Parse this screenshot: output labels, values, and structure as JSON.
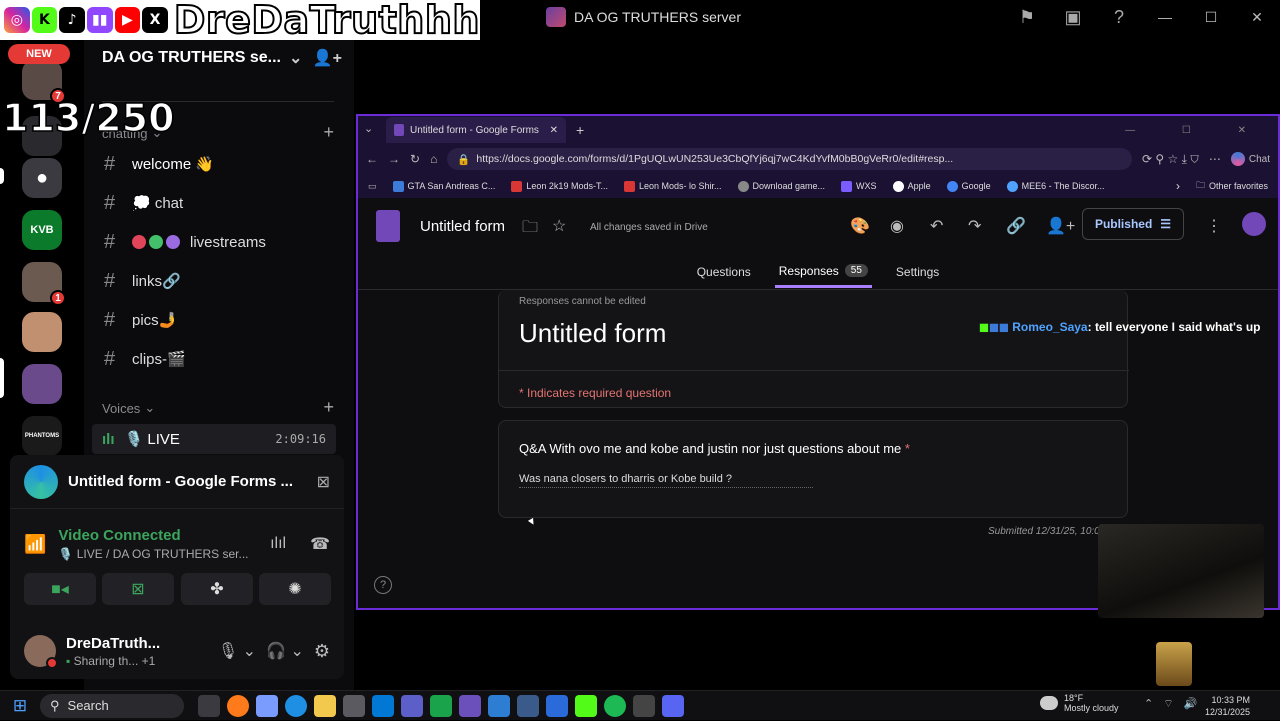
{
  "overlay": {
    "streamer_name": "DreDaTruthhh",
    "counter": "113/250",
    "social_icons": [
      "instagram-icon",
      "kick-icon",
      "tiktok-icon",
      "twitch-icon",
      "youtube-icon",
      "x-icon"
    ]
  },
  "window": {
    "title": "DA OG TRUTHERS server"
  },
  "rail": {
    "new_badge": "NEW",
    "servers": [
      {
        "label": "",
        "badge": "7"
      },
      {
        "label": "",
        "badge": ""
      },
      {
        "label": "",
        "badge": ""
      },
      {
        "label": "KVB",
        "badge": ""
      },
      {
        "label": "",
        "badge": "1"
      },
      {
        "label": "",
        "badge": ""
      },
      {
        "label": "",
        "badge": ""
      },
      {
        "label": "PHANTOMS",
        "badge": ""
      }
    ]
  },
  "sidebar": {
    "server_name": "DA OG TRUTHERS se...",
    "categories": {
      "chatting": "chatting",
      "voices": "Voices"
    },
    "channels": [
      {
        "name": "welcome 👋"
      },
      {
        "name": "💭 chat"
      },
      {
        "name": "livestreams"
      },
      {
        "name": "links🔗"
      },
      {
        "name": "pics🤳"
      },
      {
        "name": "clips-🎬"
      }
    ],
    "live_channel": {
      "name": "🎙️ LIVE",
      "time": "2:09:16"
    }
  },
  "voice_panel": {
    "stream_title": "Untitled form - Google Forms ...",
    "status": "Video Connected",
    "sub": "🎙️ LIVE / DA OG TRUTHERS ser...",
    "user_name": "DreDaTruth...",
    "user_status": "Sharing th...",
    "user_status_extra": "+1"
  },
  "browser": {
    "tab_title": "Untitled form - Google Forms",
    "url": "https://docs.google.com/forms/d/1PgUQLwUN253Ue3CbQfYj6qj7wC4KdYvfM0bB0gVeRr0/edit#resp...",
    "chat_button": "Chat",
    "favorites": [
      "GTA San Andreas C...",
      "Leon 2k19 Mods-T...",
      "Leon Mods- lo Shir...",
      "Download game...",
      "WXS",
      "Apple",
      "Google",
      "MEE6 - The Discor..."
    ],
    "favorites_colors": [
      "#3d7bd9",
      "#d93636",
      "#d93636",
      "#888888",
      "#7a5cff",
      "#ffffff",
      "#4285f4",
      "#4fa3ff"
    ],
    "other_favorites": "Other favorites"
  },
  "form": {
    "title": "Untitled form",
    "saved_status": "All changes saved in Drive",
    "publish_label": "Published",
    "tabs": {
      "questions": "Questions",
      "responses": "Responses",
      "responses_count": "55",
      "settings": "Settings"
    },
    "cannot_edit": "Responses cannot be edited",
    "big_title": "Untitled form",
    "required_note": "* Indicates required question",
    "question": "Q&A With ovo me and kobe and justin nor just questions about me",
    "question_star": "*",
    "answer": "Was nana closers to dharris or Kobe build ?",
    "submitted": "Submitted 12/31/25, 10:0..."
  },
  "chat_overlay": {
    "user": "Romeo_Saya",
    "message": ": tell everyone I said what's up"
  },
  "taskbar": {
    "search_placeholder": "Search",
    "weather_temp": "18°F",
    "weather_desc": "Mostly cloudy",
    "time": "10:33 PM",
    "date": "12/31/2025"
  },
  "colors": {
    "accent_purple": "#6b2bd9",
    "discord_green": "#3ba55d",
    "forms_purple": "#7248b9",
    "required_red": "#e57373"
  }
}
